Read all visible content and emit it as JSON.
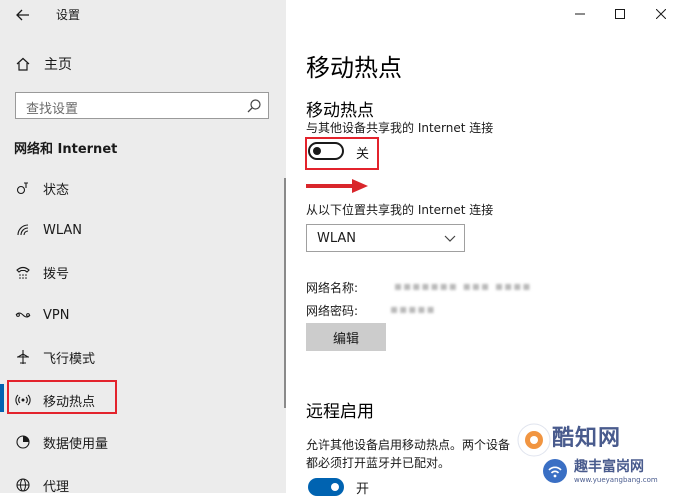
{
  "window": {
    "title": "设置"
  },
  "sidebar": {
    "home_label": "主页",
    "search_placeholder": "查找设置",
    "section_heading": "网络和 Internet",
    "items": [
      {
        "label": "状态",
        "icon": "status-icon"
      },
      {
        "label": "WLAN",
        "icon": "wifi-icon"
      },
      {
        "label": "拨号",
        "icon": "dialup-icon"
      },
      {
        "label": "VPN",
        "icon": "vpn-icon"
      },
      {
        "label": "飞行模式",
        "icon": "airplane-icon"
      },
      {
        "label": "移动热点",
        "icon": "hotspot-icon",
        "active": true
      },
      {
        "label": "数据使用量",
        "icon": "data-usage-icon"
      },
      {
        "label": "代理",
        "icon": "globe-icon"
      }
    ]
  },
  "main": {
    "page_title": "移动热点",
    "hotspot_heading": "移动热点",
    "share_description": "与其他设备共享我的 Internet 连接",
    "hotspot_toggle": {
      "state": "off",
      "label": "关"
    },
    "share_from_label": "从以下位置共享我的 Internet 连接",
    "share_from_value": "WLAN",
    "network_name_label": "网络名称:",
    "network_password_label": "网络密码:",
    "edit_button": "编辑",
    "remote_heading": "远程启用",
    "remote_description": "允许其他设备启用移动热点。两个设备都必须打开蓝牙并已配对。",
    "remote_toggle": {
      "state": "on",
      "label": "开"
    }
  },
  "watermark": {
    "brand": "酷知网",
    "sub": "趣丰富岗网",
    "url": "www.yueyangbang.com"
  },
  "colors": {
    "accent": "#0063b1",
    "highlight_box": "#e3232c",
    "sidebar_bg": "#ececec"
  }
}
